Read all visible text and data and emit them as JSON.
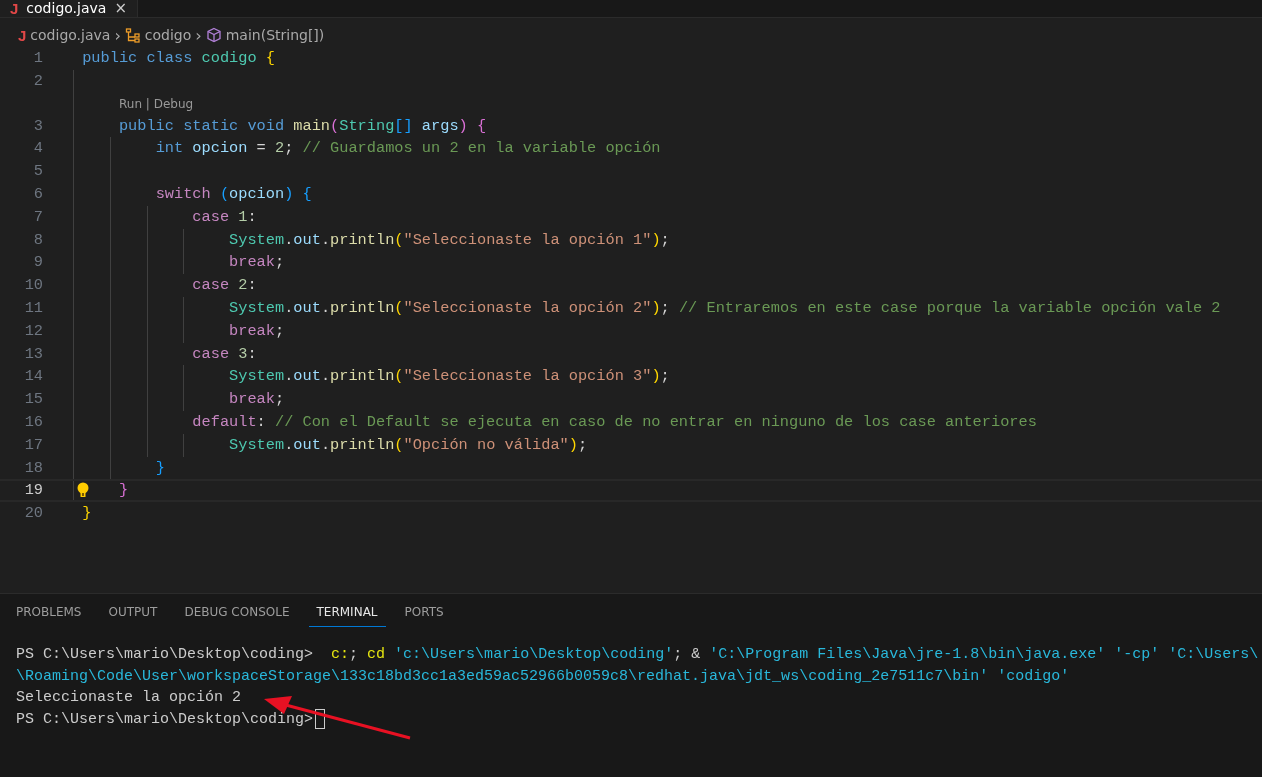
{
  "tabs": [
    {
      "icon": "J",
      "label": "codigo.java",
      "close": "×",
      "selected": true
    }
  ],
  "breadcrumb": [
    {
      "kind": "file",
      "icon": "J",
      "label": "codigo.java"
    },
    {
      "kind": "class",
      "label": "codigo"
    },
    {
      "kind": "method",
      "label": "main(String[])"
    }
  ],
  "breadcrumb_separator": "›",
  "lines": [
    {
      "number": "1",
      "current": false,
      "tokens": [
        {
          "text": "public class ",
          "kind": "keyword"
        },
        {
          "text": "codigo ",
          "kind": "type"
        },
        {
          "text": "{",
          "kind": "bracket1"
        }
      ]
    },
    {
      "number": "2",
      "current": false
    },
    {
      "number": "3",
      "current": false,
      "code_lens": {
        "run": "Run",
        "separator": "|",
        "debug": "Debug"
      },
      "tokens": [
        {
          "text": "    public static void ",
          "kind": "keyword"
        },
        {
          "text": "main",
          "kind": "func"
        },
        {
          "text": "(",
          "kind": "bracket2"
        },
        {
          "text": "String",
          "kind": "type"
        },
        {
          "text": "[]",
          "kind": "bracket3"
        },
        {
          "text": " args",
          "kind": "var"
        },
        {
          "text": ") {",
          "kind": "bracket2"
        }
      ]
    },
    {
      "number": "4",
      "current": false,
      "tokens": [
        {
          "text": "        int ",
          "kind": "keyword"
        },
        {
          "text": "opcion",
          "kind": "var"
        },
        {
          "text": " = ",
          "kind": "plain"
        },
        {
          "text": "2",
          "kind": "number"
        },
        {
          "text": "; ",
          "kind": "plain"
        },
        {
          "text": "// Guardamos un 2 en la variable opción",
          "kind": "comment"
        }
      ]
    },
    {
      "number": "5",
      "current": false
    },
    {
      "number": "6",
      "current": false,
      "tokens": [
        {
          "text": "        switch ",
          "kind": "control"
        },
        {
          "text": "(",
          "kind": "bracket3"
        },
        {
          "text": "opcion",
          "kind": "var"
        },
        {
          "text": ") {",
          "kind": "bracket3"
        }
      ]
    },
    {
      "number": "7",
      "current": false,
      "tokens": [
        {
          "text": "            case ",
          "kind": "control"
        },
        {
          "text": "1",
          "kind": "number"
        },
        {
          "text": ":",
          "kind": "plain"
        }
      ]
    },
    {
      "number": "8",
      "current": false,
      "tokens": [
        {
          "text": "                System",
          "kind": "type"
        },
        {
          "text": ".",
          "kind": "plain"
        },
        {
          "text": "out",
          "kind": "var"
        },
        {
          "text": ".",
          "kind": "plain"
        },
        {
          "text": "println",
          "kind": "func"
        },
        {
          "text": "(",
          "kind": "bracket1"
        },
        {
          "text": "\"Seleccionaste la opción 1\"",
          "kind": "string"
        },
        {
          "text": ")",
          "kind": "bracket1"
        },
        {
          "text": ";",
          "kind": "plain"
        }
      ]
    },
    {
      "number": "9",
      "current": false,
      "tokens": [
        {
          "text": "                break",
          "kind": "control"
        },
        {
          "text": ";",
          "kind": "plain"
        }
      ]
    },
    {
      "number": "10",
      "current": false,
      "tokens": [
        {
          "text": "            case ",
          "kind": "control"
        },
        {
          "text": "2",
          "kind": "number"
        },
        {
          "text": ":",
          "kind": "plain"
        }
      ]
    },
    {
      "number": "11",
      "current": false,
      "tokens": [
        {
          "text": "                System",
          "kind": "type"
        },
        {
          "text": ".",
          "kind": "plain"
        },
        {
          "text": "out",
          "kind": "var"
        },
        {
          "text": ".",
          "kind": "plain"
        },
        {
          "text": "println",
          "kind": "func"
        },
        {
          "text": "(",
          "kind": "bracket1"
        },
        {
          "text": "\"Seleccionaste la opción 2\"",
          "kind": "string"
        },
        {
          "text": ")",
          "kind": "bracket1"
        },
        {
          "text": "; ",
          "kind": "plain"
        },
        {
          "text": "// Entraremos en este case porque la variable opción vale 2",
          "kind": "comment"
        }
      ]
    },
    {
      "number": "12",
      "current": false,
      "tokens": [
        {
          "text": "                break",
          "kind": "control"
        },
        {
          "text": ";",
          "kind": "plain"
        }
      ]
    },
    {
      "number": "13",
      "current": false,
      "tokens": [
        {
          "text": "            case ",
          "kind": "control"
        },
        {
          "text": "3",
          "kind": "number"
        },
        {
          "text": ":",
          "kind": "plain"
        }
      ]
    },
    {
      "number": "14",
      "current": false,
      "tokens": [
        {
          "text": "                System",
          "kind": "type"
        },
        {
          "text": ".",
          "kind": "plain"
        },
        {
          "text": "out",
          "kind": "var"
        },
        {
          "text": ".",
          "kind": "plain"
        },
        {
          "text": "println",
          "kind": "func"
        },
        {
          "text": "(",
          "kind": "bracket1"
        },
        {
          "text": "\"Seleccionaste la opción 3\"",
          "kind": "string"
        },
        {
          "text": ")",
          "kind": "bracket1"
        },
        {
          "text": ";",
          "kind": "plain"
        }
      ]
    },
    {
      "number": "15",
      "current": false,
      "tokens": [
        {
          "text": "                break",
          "kind": "control"
        },
        {
          "text": ";",
          "kind": "plain"
        }
      ]
    },
    {
      "number": "16",
      "current": false,
      "tokens": [
        {
          "text": "            default",
          "kind": "control"
        },
        {
          "text": ": ",
          "kind": "plain"
        },
        {
          "text": "// Con el Default se ejecuta en caso de no entrar en ninguno de los case anteriores",
          "kind": "comment"
        }
      ]
    },
    {
      "number": "17",
      "current": false,
      "tokens": [
        {
          "text": "                System",
          "kind": "type"
        },
        {
          "text": ".",
          "kind": "plain"
        },
        {
          "text": "out",
          "kind": "var"
        },
        {
          "text": ".",
          "kind": "plain"
        },
        {
          "text": "println",
          "kind": "func"
        },
        {
          "text": "(",
          "kind": "bracket1"
        },
        {
          "text": "\"Opción no válida\"",
          "kind": "string"
        },
        {
          "text": ")",
          "kind": "bracket1"
        },
        {
          "text": ";",
          "kind": "plain"
        }
      ]
    },
    {
      "number": "18",
      "current": false,
      "tokens": [
        {
          "text": "        }",
          "kind": "bracket3"
        }
      ]
    },
    {
      "number": "19",
      "current": true,
      "lightbulb": true,
      "tokens": [
        {
          "text": "    }",
          "kind": "bracket2"
        }
      ]
    },
    {
      "number": "20",
      "current": false,
      "tokens": [
        {
          "text": "}",
          "kind": "bracket1"
        }
      ]
    }
  ],
  "panel_tabs": [
    {
      "label": "PROBLEMS",
      "selected": false
    },
    {
      "label": "OUTPUT",
      "selected": false
    },
    {
      "label": "DEBUG CONSOLE",
      "selected": false
    },
    {
      "label": "TERMINAL",
      "selected": true
    },
    {
      "label": "PORTS",
      "selected": false
    }
  ],
  "terminal": [
    {
      "cursor": false,
      "tokens": [
        {
          "text": "PS C:\\Users\\mario\\Desktop\\coding>  ",
          "kind": "plain"
        },
        {
          "text": "c:",
          "kind": "yellow"
        },
        {
          "text": "; ",
          "kind": "plain"
        },
        {
          "text": "cd ",
          "kind": "yellow"
        },
        {
          "text": "'c:\\Users\\mario\\Desktop\\coding'",
          "kind": "cyan"
        },
        {
          "text": "; & ",
          "kind": "plain"
        },
        {
          "text": "'C:\\Program Files\\Java\\jre-1.8\\bin\\java.exe' '-cp' 'C:\\Users\\",
          "kind": "cyan"
        }
      ]
    },
    {
      "cursor": false,
      "tokens": [
        {
          "text": "\\Roaming\\Code\\User\\workspaceStorage\\133c18bd3cc1a3ed59ac52966b0059c8\\redhat.java\\jdt_ws\\coding_2e7511c7\\bin' 'codigo'",
          "kind": "cyan"
        }
      ]
    },
    {
      "cursor": false,
      "tokens": [
        {
          "text": "Seleccionaste la opción 2",
          "kind": "plain"
        }
      ]
    },
    {
      "cursor": true,
      "tokens": [
        {
          "text": "PS C:\\Users\\mario\\Desktop\\coding>",
          "kind": "plain"
        }
      ]
    }
  ]
}
